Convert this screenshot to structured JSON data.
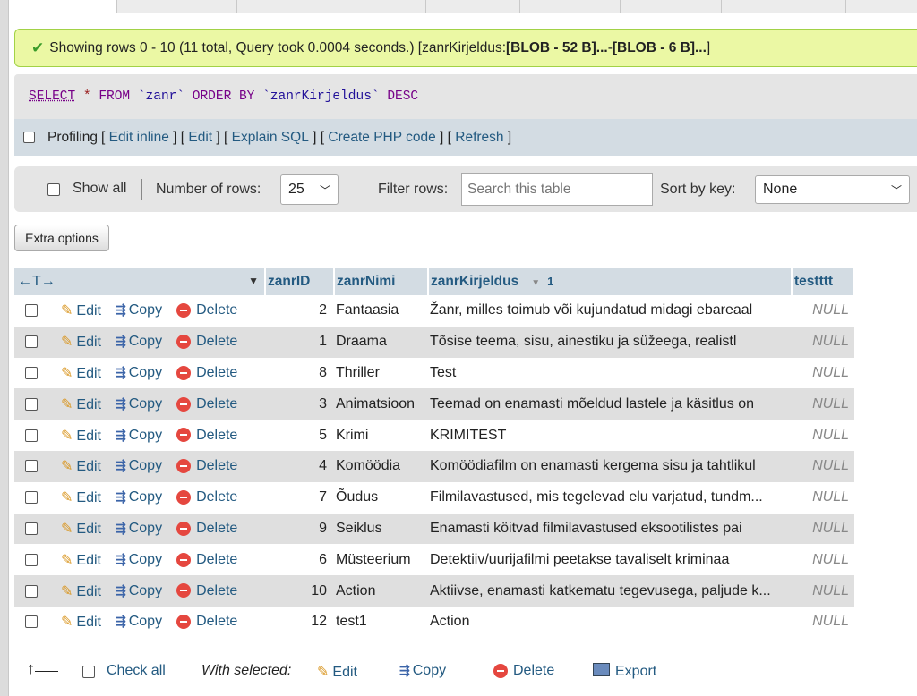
{
  "message": {
    "prefix": "Showing rows 0 - 10 (11 total, Query took 0.0004 seconds.) [zanrKirjeldus: ",
    "blob1": "[BLOB - 52 B]...",
    "sep": " - ",
    "blob2": "[BLOB - 6 B]...",
    "suffix": "]"
  },
  "sql": {
    "select": "SELECT",
    "star": " * ",
    "from": "FROM",
    "table": " `zanr` ",
    "orderby": "ORDER BY",
    "col": " `zanrKirjeldus` ",
    "desc": "DESC"
  },
  "profiling": {
    "label": "Profiling",
    "links": [
      "Edit inline",
      "Edit",
      "Explain SQL",
      "Create PHP code",
      "Refresh"
    ]
  },
  "nav": {
    "show_all": "Show all",
    "rows_label": "Number of rows:",
    "rows_value": "25",
    "filter_label": "Filter rows:",
    "filter_placeholder": "Search this table",
    "sort_label": "Sort by key:",
    "sort_value": "None"
  },
  "extra_options": "Extra options",
  "table": {
    "arrows": "←T→",
    "headers": [
      "zanrID",
      "zanrNimi",
      "zanrKirjeldus",
      "testttt"
    ],
    "sort_marker": "1",
    "actions": {
      "edit": "Edit",
      "copy": "Copy",
      "delete": "Delete"
    },
    "rows": [
      [
        "2",
        "Fantaasia",
        "Žanr, milles toimub või kujundatud midagi ebareaal",
        "NULL"
      ],
      [
        "1",
        "Draama",
        "Tõsise teema, sisu, ainestiku ja süžeega, realistl",
        "NULL"
      ],
      [
        "8",
        "Thriller",
        "Test",
        "NULL"
      ],
      [
        "3",
        "Animatsioon",
        "Teemad on enamasti mõeldud lastele ja käsitlus on",
        "NULL"
      ],
      [
        "5",
        "Krimi",
        "KRIMITEST",
        "NULL"
      ],
      [
        "4",
        "Komöödia",
        "Komöödiafilm on enamasti kergema sisu ja tahtlikul",
        "NULL"
      ],
      [
        "7",
        "Õudus",
        "Filmilavastused, mis tegelevad elu varjatud, tundm...",
        "NULL"
      ],
      [
        "9",
        "Seiklus",
        "Enamasti köitvad filmilavastused eksootilistes pai",
        "NULL"
      ],
      [
        "6",
        "Müsteerium",
        "Detektiiv/uurijafilmi peetakse tavaliselt kriminaa",
        "NULL"
      ],
      [
        "10",
        "Action",
        "Aktiivse, enamasti katkematu tegevusega, paljude k...",
        "NULL"
      ],
      [
        "12",
        "test1",
        "Action",
        "NULL"
      ]
    ]
  },
  "footer": {
    "check_all": "Check all",
    "with_selected": "With selected:",
    "edit": "Edit",
    "copy": "Copy",
    "delete": "Delete",
    "export": "Export"
  }
}
